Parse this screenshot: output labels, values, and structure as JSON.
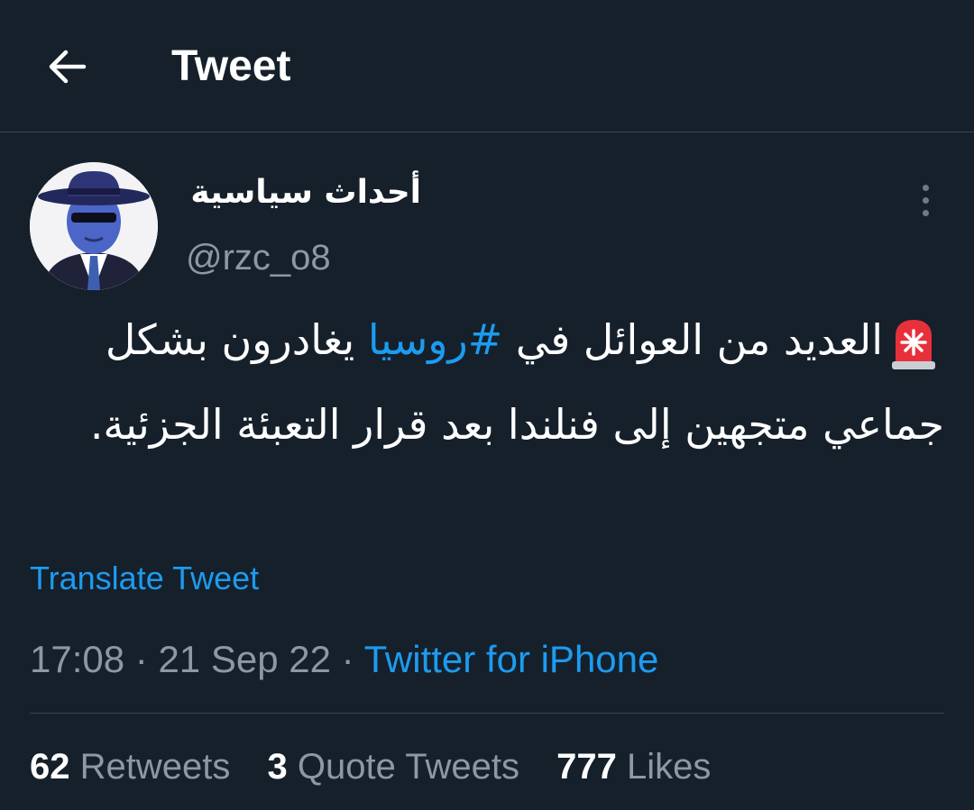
{
  "header": {
    "title": "Tweet",
    "back_icon": "arrow-left-icon"
  },
  "author": {
    "display_name": "أحداث سياسية",
    "handle": "@rzc_o8",
    "avatar_icon": "avatar-spy-hat-icon",
    "more_icon": "more-vertical-icon"
  },
  "tweet": {
    "emoji_icon": "police-siren-icon",
    "text_part1": "العديد من العوائل في ",
    "hashtag": "#روسيا",
    "text_part2": " يغادرون بشكل جماعي متجهين إلى فنلندا بعد قرار التعبئة الجزئية.",
    "translate_label": "Translate Tweet",
    "time": "17:08",
    "date": "21 Sep 22",
    "source": "Twitter for iPhone",
    "separator": "·"
  },
  "stats": {
    "retweets_count": "62",
    "retweets_label": "Retweets",
    "quotes_count": "3",
    "quotes_label": "Quote Tweets",
    "likes_count": "777",
    "likes_label": "Likes"
  },
  "colors": {
    "background": "#15202b",
    "accent": "#1d9bf0",
    "muted": "#8b98a5",
    "divider": "#38444d"
  }
}
